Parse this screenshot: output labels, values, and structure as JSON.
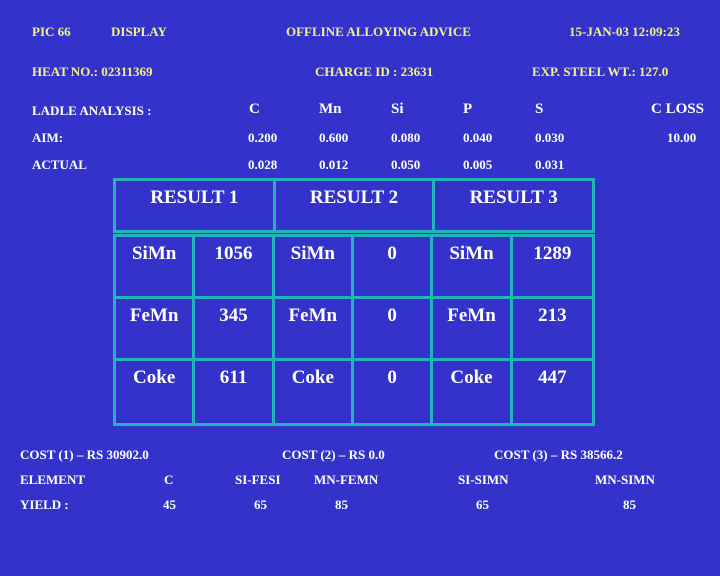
{
  "header": {
    "pic": "PIC 66",
    "mode": "DISPLAY",
    "title": "OFFLINE ALLOYING ADVICE",
    "datetime": "15-JAN-03  12:09:23",
    "heat_no": "HEAT NO.: 02311369",
    "charge_id": "CHARGE ID : 23631",
    "exp_steel_wt": "EXP. STEEL WT.:  127.0"
  },
  "ladle": {
    "label": "LADLE ANALYSIS :",
    "columns": [
      "C",
      "Mn",
      "Si",
      "P",
      "S",
      "C  LOSS"
    ],
    "aim_label": "AIM:",
    "aim": [
      "0.200",
      "0.600",
      "0.080",
      "0.040",
      "0.030",
      "10.00"
    ],
    "actual_label": "ACTUAL",
    "actual": [
      "0.028",
      "0.012",
      "0.050",
      "0.005",
      "0.031"
    ]
  },
  "results": {
    "headers": [
      "RESULT  1",
      "RESULT 2",
      "RESULT 3"
    ],
    "rows": [
      [
        "SiMn",
        "1056",
        "SiMn",
        "0",
        "SiMn",
        "1289"
      ],
      [
        "FeMn",
        "345",
        "FeMn",
        "0",
        "FeMn",
        "213"
      ],
      [
        "Coke",
        "611",
        "Coke",
        "0",
        "Coke",
        "447"
      ]
    ]
  },
  "costs": {
    "cost1": "COST (1) – RS   30902.0",
    "cost2": "COST (2) – RS  0.0",
    "cost3": "COST (3) – RS   38566.2"
  },
  "yield": {
    "element_label": "ELEMENT",
    "yield_label": "YIELD :",
    "elements": [
      "C",
      "SI-FESI",
      "MN-FEMN",
      "SI-SIMN",
      "MN-SIMN"
    ],
    "values": [
      "45",
      "65",
      "85",
      "65",
      "85"
    ]
  },
  "colors": {
    "background": "#3333cc",
    "title_text": "#f2f28a",
    "body_text": "#ffffff",
    "grid": "#22b4b8"
  }
}
